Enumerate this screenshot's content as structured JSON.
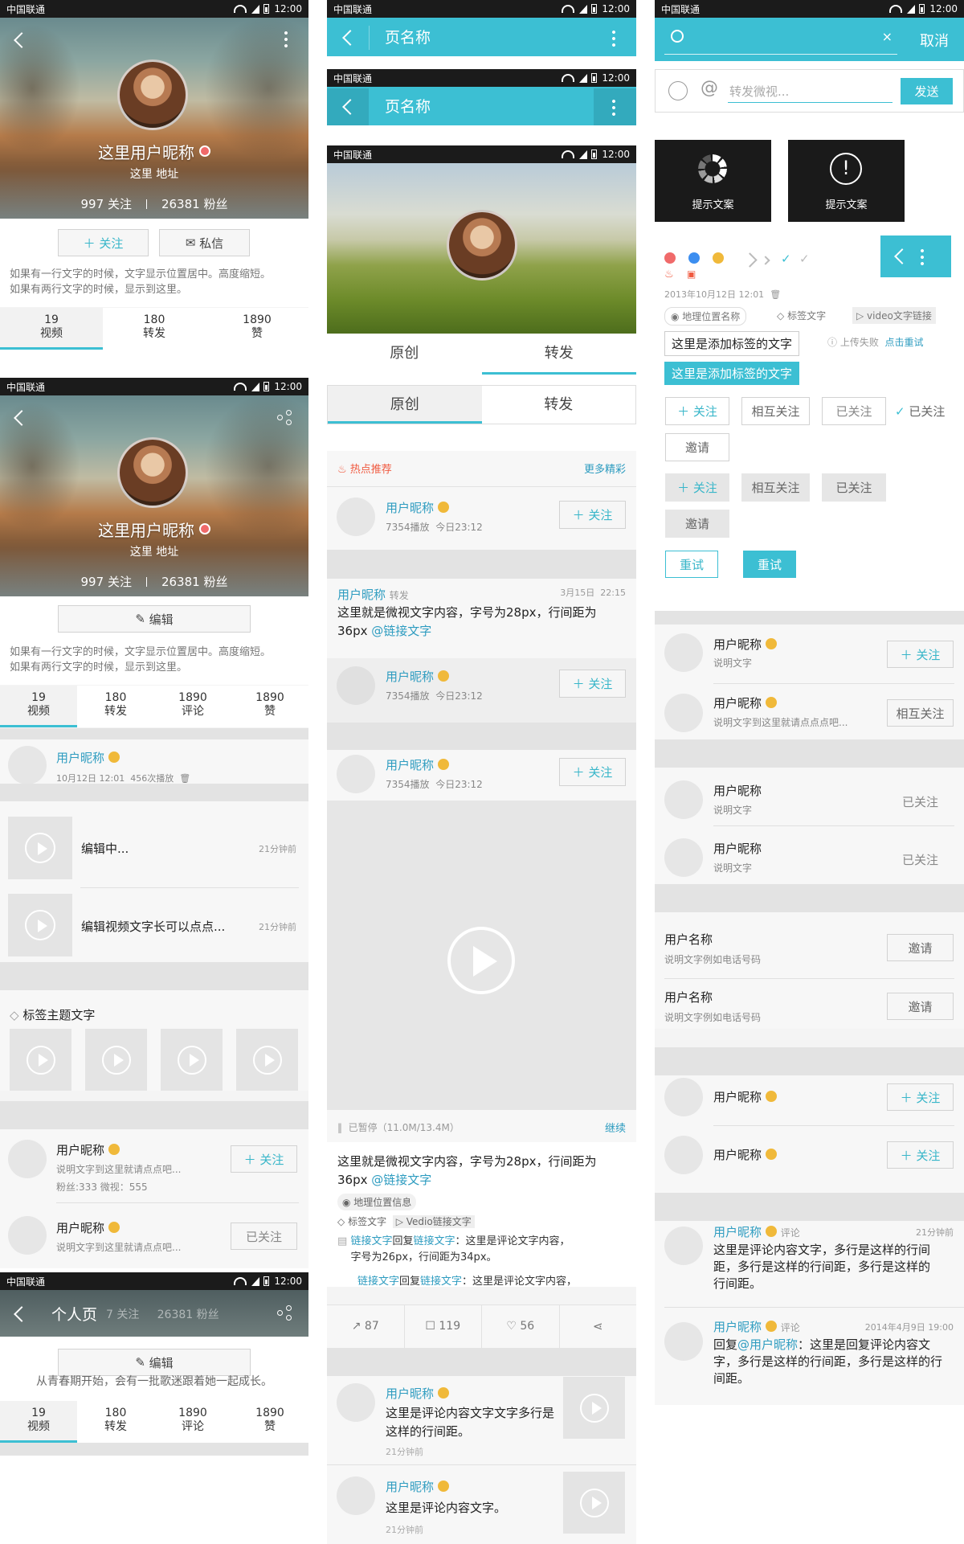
{
  "status": {
    "carrier": "中国联通",
    "time": "12:00"
  },
  "profile": {
    "nickname": "这里用户昵称",
    "address": "这里 地址",
    "following": "997",
    "following_label": "关注",
    "fans": "26381",
    "fans_label": "粉丝",
    "follow_btn": "关注",
    "message_btn": "私信",
    "edit_btn": "编辑",
    "desc1": "如果有一行文字的时候，文字显示位置居中。高度缩短。",
    "desc2": "如果有两行文字的时候，显示到这里。",
    "desc_single": "从青春期开始，会有一批歌迷跟着她一起成长。",
    "page_title": "个人页",
    "tabs3": [
      {
        "n": "19",
        "l": "视频"
      },
      {
        "n": "180",
        "l": "转发"
      },
      {
        "n": "1890",
        "l": "赞"
      }
    ],
    "tabs4": [
      {
        "n": "19",
        "l": "视频"
      },
      {
        "n": "180",
        "l": "转发"
      },
      {
        "n": "1890",
        "l": "评论"
      },
      {
        "n": "1890",
        "l": "赞"
      }
    ]
  },
  "col1": {
    "post_nick": "用户昵称",
    "post_meta": "10月12日 12:01",
    "post_plays": "456次播放",
    "draft1": "编辑中...",
    "draft2": "编辑视频文字长可以点点...",
    "draft_time": "21分钟前",
    "topic": "标签主题文字",
    "u1_nick": "用户昵称",
    "u1_desc": "说明文字到这里就请点点吧...",
    "u1_stats": "粉丝:333   微视：555",
    "u1_btn": "关注",
    "u2_nick": "用户昵称",
    "u2_desc": "说明文字到这里就请点点吧...",
    "u2_btn": "已关注"
  },
  "col2": {
    "nav_title": "页名称",
    "seg_a": "原创",
    "seg_b": "转发",
    "hot": "热点推荐",
    "more": "更多精彩",
    "nick": "用户昵称",
    "plays": "7354播放",
    "today": "今日23:12",
    "follow": "关注",
    "fw_nick": "用户昵称",
    "fw_tag": "转发",
    "fw_date": "3月15日",
    "fw_time": "22:15",
    "fw_text": "这里就是微视文字内容，字号为28px，行间距为",
    "fw_text2": "36px",
    "fw_link": "@链接文字",
    "paused": "已暂停（11.0M/13.4M）",
    "resume": "继续",
    "post_text": "这里就是微视文字内容，字号为28px，行间距为",
    "post_text2": "36px",
    "post_link": "@链接文字",
    "loc": "地理位置信息",
    "tag": "标签文字",
    "vlink": "Vedio链接文字",
    "c1a": "链接文字",
    "c1b": "回复",
    "c1c": "链接文字",
    "c1d": "：这里是评论文字内容，",
    "c1e": "字号为26px，行间距为34px。",
    "c2a": "链接文字",
    "c2b": "回复",
    "c2c": "链接文字",
    "c2d": "：这里是评论文字内容，",
    "share_n": "87",
    "cmt_n": "119",
    "like_n": "56",
    "cm1_nick": "用户昵称",
    "cm1_text": "这里是评论内容文字文字多行是",
    "cm1_text2": "这样的行间距。",
    "cm1_time": "21分钟前",
    "cm2_nick": "用户昵称",
    "cm2_text": "这里是评论内容文字。",
    "cm2_time": "21分钟前"
  },
  "col3": {
    "cancel": "取消",
    "repost_ph": "转发微视...",
    "send": "发送",
    "toast1": "提示文案",
    "toast2": "提示文案",
    "date": "2013年10月12日 12:01",
    "loc": "地理位置名称",
    "tag": "标签文字",
    "vlink": "video文字链接",
    "tagline1": "这里是添加标签的文字",
    "upload_fail": "上传失败",
    "retry_link": "点击重试",
    "tagline2": "这里是添加标签的文字",
    "b_follow": "关注",
    "b_mutual": "相互关注",
    "b_followed": "已关注",
    "b_followed2": "已关注",
    "b_invite": "邀请",
    "b_retry": "重试",
    "users": [
      {
        "nick": "用户昵称",
        "desc": "说明文字",
        "btn": "关注"
      },
      {
        "nick": "用户昵称",
        "desc": "说明文字到这里就请点点点吧...",
        "btn": "相互关注"
      },
      {
        "nick": "用户昵称",
        "desc": "说明文字",
        "btn": "已关注"
      },
      {
        "nick": "用户昵称",
        "desc": "说明文字",
        "btn": "已关注"
      }
    ],
    "contacts": [
      {
        "name": "用户名称",
        "desc": "说明文字例如电话号码",
        "btn": "邀请"
      },
      {
        "name": "用户名称",
        "desc": "说明文字例如电话号码",
        "btn": "邀请"
      }
    ],
    "simple": [
      {
        "nick": "用户昵称",
        "btn": "关注"
      },
      {
        "nick": "用户昵称",
        "btn": "关注"
      }
    ],
    "cm1_nick": "用户昵称",
    "cm1_tag": "评论",
    "cm1_time": "21分钟前",
    "cm1_text": "这里是评论内容文字，多行是这样的行间",
    "cm1_text2": "距，多行是这样的行间距，多行是这样的",
    "cm1_text3": "行间距。",
    "cm2_nick": "用户昵称",
    "cm2_tag": "评论",
    "cm2_time": "2014年4月9日 19:00",
    "cm2_pre": "回复",
    "cm2_link": "@用户昵称",
    "cm2_text": "：这里是回复评论内容文",
    "cm2_text2": "字，多行是这样的行间距，多行是这样的行",
    "cm2_text3": "间距。"
  }
}
